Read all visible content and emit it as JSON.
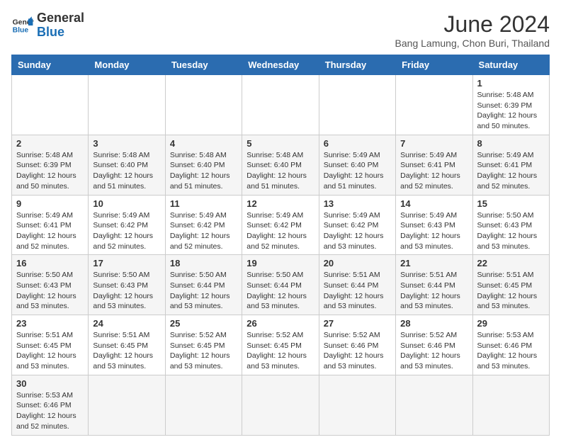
{
  "header": {
    "logo_general": "General",
    "logo_blue": "Blue",
    "title": "June 2024",
    "location": "Bang Lamung, Chon Buri, Thailand"
  },
  "weekdays": [
    "Sunday",
    "Monday",
    "Tuesday",
    "Wednesday",
    "Thursday",
    "Friday",
    "Saturday"
  ],
  "weeks": [
    [
      {
        "day": "",
        "info": ""
      },
      {
        "day": "",
        "info": ""
      },
      {
        "day": "",
        "info": ""
      },
      {
        "day": "",
        "info": ""
      },
      {
        "day": "",
        "info": ""
      },
      {
        "day": "",
        "info": ""
      },
      {
        "day": "1",
        "info": "Sunrise: 5:48 AM\nSunset: 6:39 PM\nDaylight: 12 hours\nand 50 minutes."
      }
    ],
    [
      {
        "day": "2",
        "info": "Sunrise: 5:48 AM\nSunset: 6:39 PM\nDaylight: 12 hours\nand 50 minutes."
      },
      {
        "day": "3",
        "info": "Sunrise: 5:48 AM\nSunset: 6:40 PM\nDaylight: 12 hours\nand 51 minutes."
      },
      {
        "day": "4",
        "info": "Sunrise: 5:48 AM\nSunset: 6:40 PM\nDaylight: 12 hours\nand 51 minutes."
      },
      {
        "day": "5",
        "info": "Sunrise: 5:48 AM\nSunset: 6:40 PM\nDaylight: 12 hours\nand 51 minutes."
      },
      {
        "day": "6",
        "info": "Sunrise: 5:49 AM\nSunset: 6:40 PM\nDaylight: 12 hours\nand 51 minutes."
      },
      {
        "day": "7",
        "info": "Sunrise: 5:49 AM\nSunset: 6:41 PM\nDaylight: 12 hours\nand 52 minutes."
      },
      {
        "day": "8",
        "info": "Sunrise: 5:49 AM\nSunset: 6:41 PM\nDaylight: 12 hours\nand 52 minutes."
      }
    ],
    [
      {
        "day": "9",
        "info": "Sunrise: 5:49 AM\nSunset: 6:41 PM\nDaylight: 12 hours\nand 52 minutes."
      },
      {
        "day": "10",
        "info": "Sunrise: 5:49 AM\nSunset: 6:42 PM\nDaylight: 12 hours\nand 52 minutes."
      },
      {
        "day": "11",
        "info": "Sunrise: 5:49 AM\nSunset: 6:42 PM\nDaylight: 12 hours\nand 52 minutes."
      },
      {
        "day": "12",
        "info": "Sunrise: 5:49 AM\nSunset: 6:42 PM\nDaylight: 12 hours\nand 52 minutes."
      },
      {
        "day": "13",
        "info": "Sunrise: 5:49 AM\nSunset: 6:42 PM\nDaylight: 12 hours\nand 53 minutes."
      },
      {
        "day": "14",
        "info": "Sunrise: 5:49 AM\nSunset: 6:43 PM\nDaylight: 12 hours\nand 53 minutes."
      },
      {
        "day": "15",
        "info": "Sunrise: 5:50 AM\nSunset: 6:43 PM\nDaylight: 12 hours\nand 53 minutes."
      }
    ],
    [
      {
        "day": "16",
        "info": "Sunrise: 5:50 AM\nSunset: 6:43 PM\nDaylight: 12 hours\nand 53 minutes."
      },
      {
        "day": "17",
        "info": "Sunrise: 5:50 AM\nSunset: 6:43 PM\nDaylight: 12 hours\nand 53 minutes."
      },
      {
        "day": "18",
        "info": "Sunrise: 5:50 AM\nSunset: 6:44 PM\nDaylight: 12 hours\nand 53 minutes."
      },
      {
        "day": "19",
        "info": "Sunrise: 5:50 AM\nSunset: 6:44 PM\nDaylight: 12 hours\nand 53 minutes."
      },
      {
        "day": "20",
        "info": "Sunrise: 5:51 AM\nSunset: 6:44 PM\nDaylight: 12 hours\nand 53 minutes."
      },
      {
        "day": "21",
        "info": "Sunrise: 5:51 AM\nSunset: 6:44 PM\nDaylight: 12 hours\nand 53 minutes."
      },
      {
        "day": "22",
        "info": "Sunrise: 5:51 AM\nSunset: 6:45 PM\nDaylight: 12 hours\nand 53 minutes."
      }
    ],
    [
      {
        "day": "23",
        "info": "Sunrise: 5:51 AM\nSunset: 6:45 PM\nDaylight: 12 hours\nand 53 minutes."
      },
      {
        "day": "24",
        "info": "Sunrise: 5:51 AM\nSunset: 6:45 PM\nDaylight: 12 hours\nand 53 minutes."
      },
      {
        "day": "25",
        "info": "Sunrise: 5:52 AM\nSunset: 6:45 PM\nDaylight: 12 hours\nand 53 minutes."
      },
      {
        "day": "26",
        "info": "Sunrise: 5:52 AM\nSunset: 6:45 PM\nDaylight: 12 hours\nand 53 minutes."
      },
      {
        "day": "27",
        "info": "Sunrise: 5:52 AM\nSunset: 6:46 PM\nDaylight: 12 hours\nand 53 minutes."
      },
      {
        "day": "28",
        "info": "Sunrise: 5:52 AM\nSunset: 6:46 PM\nDaylight: 12 hours\nand 53 minutes."
      },
      {
        "day": "29",
        "info": "Sunrise: 5:53 AM\nSunset: 6:46 PM\nDaylight: 12 hours\nand 53 minutes."
      }
    ],
    [
      {
        "day": "30",
        "info": "Sunrise: 5:53 AM\nSunset: 6:46 PM\nDaylight: 12 hours\nand 52 minutes."
      },
      {
        "day": "",
        "info": ""
      },
      {
        "day": "",
        "info": ""
      },
      {
        "day": "",
        "info": ""
      },
      {
        "day": "",
        "info": ""
      },
      {
        "day": "",
        "info": ""
      },
      {
        "day": "",
        "info": ""
      }
    ]
  ]
}
